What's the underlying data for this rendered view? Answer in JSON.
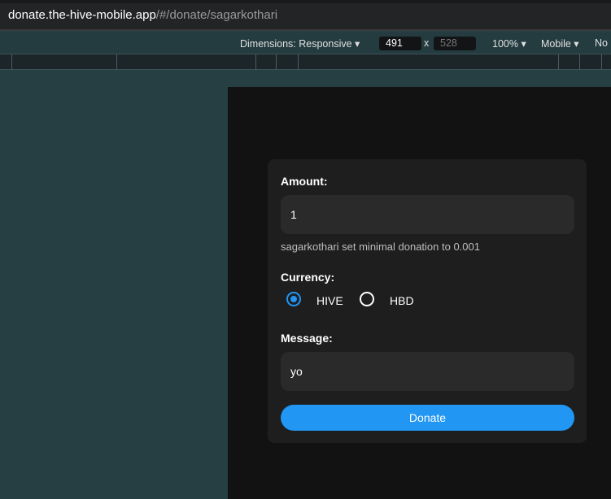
{
  "browser": {
    "url_host": "donate.the-hive-mobile.app",
    "url_path": "/#/donate/sagarkothari"
  },
  "devtools": {
    "dimensions": "Dimensions: Responsive ▾",
    "width": "491",
    "times": "x",
    "height": "528",
    "zoom": "100% ▾",
    "device": "Mobile ▾",
    "throttle": "No"
  },
  "form": {
    "amount_label": "Amount:",
    "amount_value": "1",
    "hint": "sagarkothari set minimal donation to 0.001",
    "currency_label": "Currency:",
    "currencies": [
      {
        "label": "HIVE",
        "selected": true
      },
      {
        "label": "HBD",
        "selected": false
      }
    ],
    "message_label": "Message:",
    "message_value": "yo",
    "donate_label": "Donate"
  },
  "colors": {
    "accent": "#2196f3"
  }
}
